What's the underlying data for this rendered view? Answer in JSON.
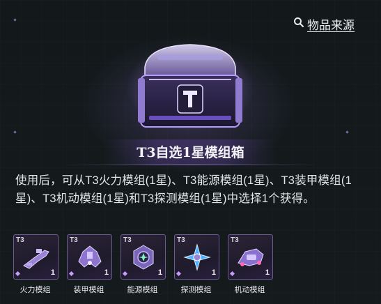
{
  "header": {
    "source_label": "物品来源",
    "source_icon": "search-icon"
  },
  "item": {
    "title": "T3自选1星模组箱",
    "description": "使用后，可从T3火力模组(1星)、T3能源模组(1星)、T3装甲模组(1星)、T3机动模组(1星)和T3探测模组(1星)中选择1个获得。",
    "icon": "treasure-chest-icon"
  },
  "modules": [
    {
      "tier": "T3",
      "count": "1",
      "label": "火力模组",
      "icon": "gun-module-icon"
    },
    {
      "tier": "T3",
      "count": "1",
      "label": "装甲模组",
      "icon": "armor-module-icon"
    },
    {
      "tier": "T3",
      "count": "1",
      "label": "能源模组",
      "icon": "energy-module-icon"
    },
    {
      "tier": "T3",
      "count": "1",
      "label": "探测模组",
      "icon": "detect-module-icon"
    },
    {
      "tier": "T3",
      "count": "1",
      "label": "机动模组",
      "icon": "mobility-module-icon"
    }
  ],
  "colors": {
    "accent_purple": "#8b6ad8",
    "frame": "#6e5a92",
    "background": "#141a1c"
  }
}
